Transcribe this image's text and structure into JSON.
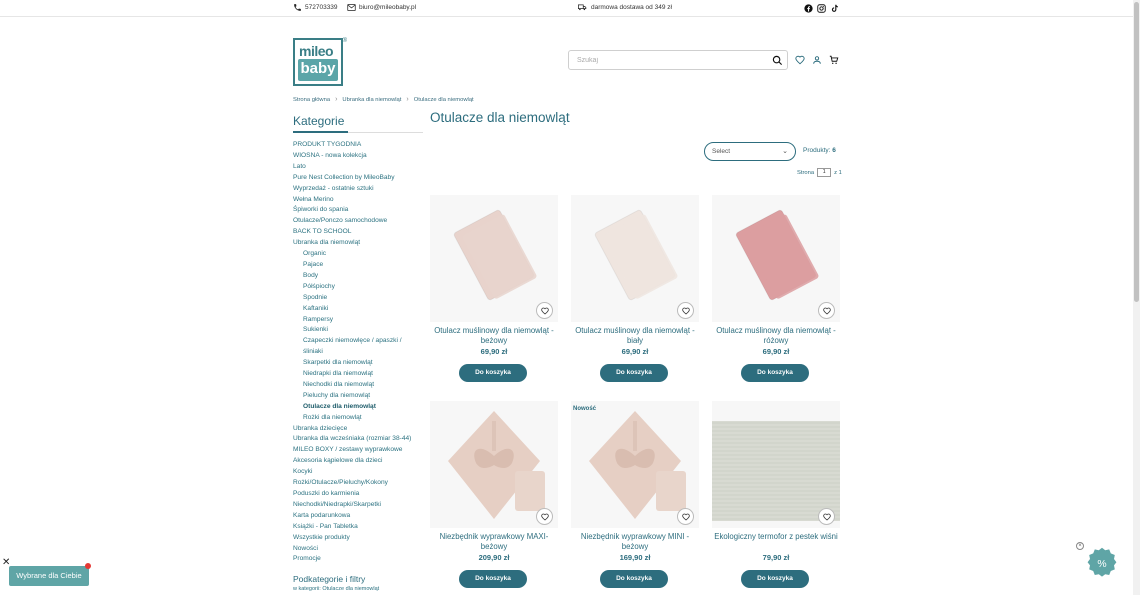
{
  "topbar": {
    "phone": "572703339",
    "email": "biuro@mileobaby.pl",
    "shipping": "darmowa dostawa od 349 zł"
  },
  "logo": {
    "top": "mileo",
    "bottom": "baby",
    "reg": "®"
  },
  "search": {
    "placeholder": "Szukaj"
  },
  "breadcrumb": [
    "Strona główna",
    "Ubranka dla niemowląt",
    "Otulacze dla niemowląt"
  ],
  "sidebar": {
    "title": "Kategorie",
    "categories": [
      {
        "label": "PRODUKT TYGODNIA",
        "level": 0
      },
      {
        "label": "WIOSNA - nowa kolekcja",
        "level": 0
      },
      {
        "label": "Lato",
        "level": 0
      },
      {
        "label": "Pure Nest Collection by MileoBaby",
        "level": 0
      },
      {
        "label": "Wyprzedaż - ostatnie sztuki",
        "level": 0
      },
      {
        "label": "Wełna Merino",
        "level": 0
      },
      {
        "label": "Śpiworki do spania",
        "level": 0
      },
      {
        "label": "Otulacze/Ponczo samochodowe",
        "level": 0
      },
      {
        "label": "BACK TO SCHOOL",
        "level": 0
      },
      {
        "label": "Ubranka dla niemowląt",
        "level": 0
      },
      {
        "label": "Organic",
        "level": 1
      },
      {
        "label": "Pajace",
        "level": 1
      },
      {
        "label": "Body",
        "level": 1
      },
      {
        "label": "Półśpiochy",
        "level": 1
      },
      {
        "label": "Spodnie",
        "level": 1
      },
      {
        "label": "Kaftaniki",
        "level": 1
      },
      {
        "label": "Rampersy",
        "level": 1
      },
      {
        "label": "Sukienki",
        "level": 1
      },
      {
        "label": "Czapeczki niemowlęce / apaszki /",
        "level": 1
      },
      {
        "label": "śliniaki",
        "level": 1
      },
      {
        "label": "Skarpetki dla niemowląt",
        "level": 1
      },
      {
        "label": "Niedrapki dla niemowląt",
        "level": 1
      },
      {
        "label": "Niechodki dla niemowląt",
        "level": 1
      },
      {
        "label": "Pieluchy dla niemowląt",
        "level": 1
      },
      {
        "label": "Otulacze dla niemowląt",
        "level": 1,
        "active": true
      },
      {
        "label": "Rożki dla niemowląt",
        "level": 1
      },
      {
        "label": "Ubranka dziecięce",
        "level": 0
      },
      {
        "label": "Ubranka dla wcześniaka (rozmiar 38-44)",
        "level": 0
      },
      {
        "label": "MILEO BOXY / zestawy wyprawkowe",
        "level": 0
      },
      {
        "label": "Akcesoria kąpielowe dla dzieci",
        "level": 0
      },
      {
        "label": "Kocyki",
        "level": 0
      },
      {
        "label": "Rożki/Otulacze/Pieluchy/Kokony",
        "level": 0
      },
      {
        "label": "Poduszki do karmienia",
        "level": 0
      },
      {
        "label": "Niechodki/Niedrapki/Skarpetki",
        "level": 0
      },
      {
        "label": "Karta podarunkowa",
        "level": 0
      },
      {
        "label": "Książki - Pan Tabletka",
        "level": 0
      },
      {
        "label": "Wszystkie produkty",
        "level": 0
      },
      {
        "label": "Nowości",
        "level": 0
      },
      {
        "label": "Promocje",
        "level": 0
      }
    ],
    "subtitle": "Podkategorie i filtry",
    "subnote": "w kategorii: Otulacze dla niemowląt"
  },
  "main": {
    "title": "Otulacze dla niemowląt",
    "sort_placeholder": "Select",
    "count_label": "Produkty:",
    "count_value": "6",
    "pager_label": "Strona",
    "pager_value": "1",
    "pager_next": "z 1",
    "new_badge": "Nowość",
    "add_label": "Do koszyka",
    "products": [
      {
        "name": "Otulacz muślinowy dla niemowląt - beżowy",
        "price": "69,90 zł",
        "color": "#e8d3cc"
      },
      {
        "name": "Otulacz muślinowy dla niemowląt - biały",
        "price": "69,90 zł",
        "color": "#efe5df"
      },
      {
        "name": "Otulacz muślinowy dla niemowląt - różowy",
        "price": "69,90 zł",
        "color": "#dc9ea0"
      },
      {
        "name": "Niezbędnik wyprawkowy MAXI- beżowy",
        "price": "209,90 zł",
        "color": "#e6cfc4"
      },
      {
        "name": "Niezbędnik wyprawkowy MINI - beżowy",
        "price": "169,90 zł",
        "color": "#e6cfc4"
      },
      {
        "name": "Ekologiczny termofor z pestek wiśni",
        "price": "79,90 zł",
        "color": "#d8dad2"
      }
    ]
  },
  "floating": {
    "chosen_label": "Wybrane dla Ciebie",
    "promo_symbol": "%"
  },
  "colors": {
    "brand": "#2d6d7e",
    "accent": "#5fa5a6",
    "notification": "#e53935"
  }
}
